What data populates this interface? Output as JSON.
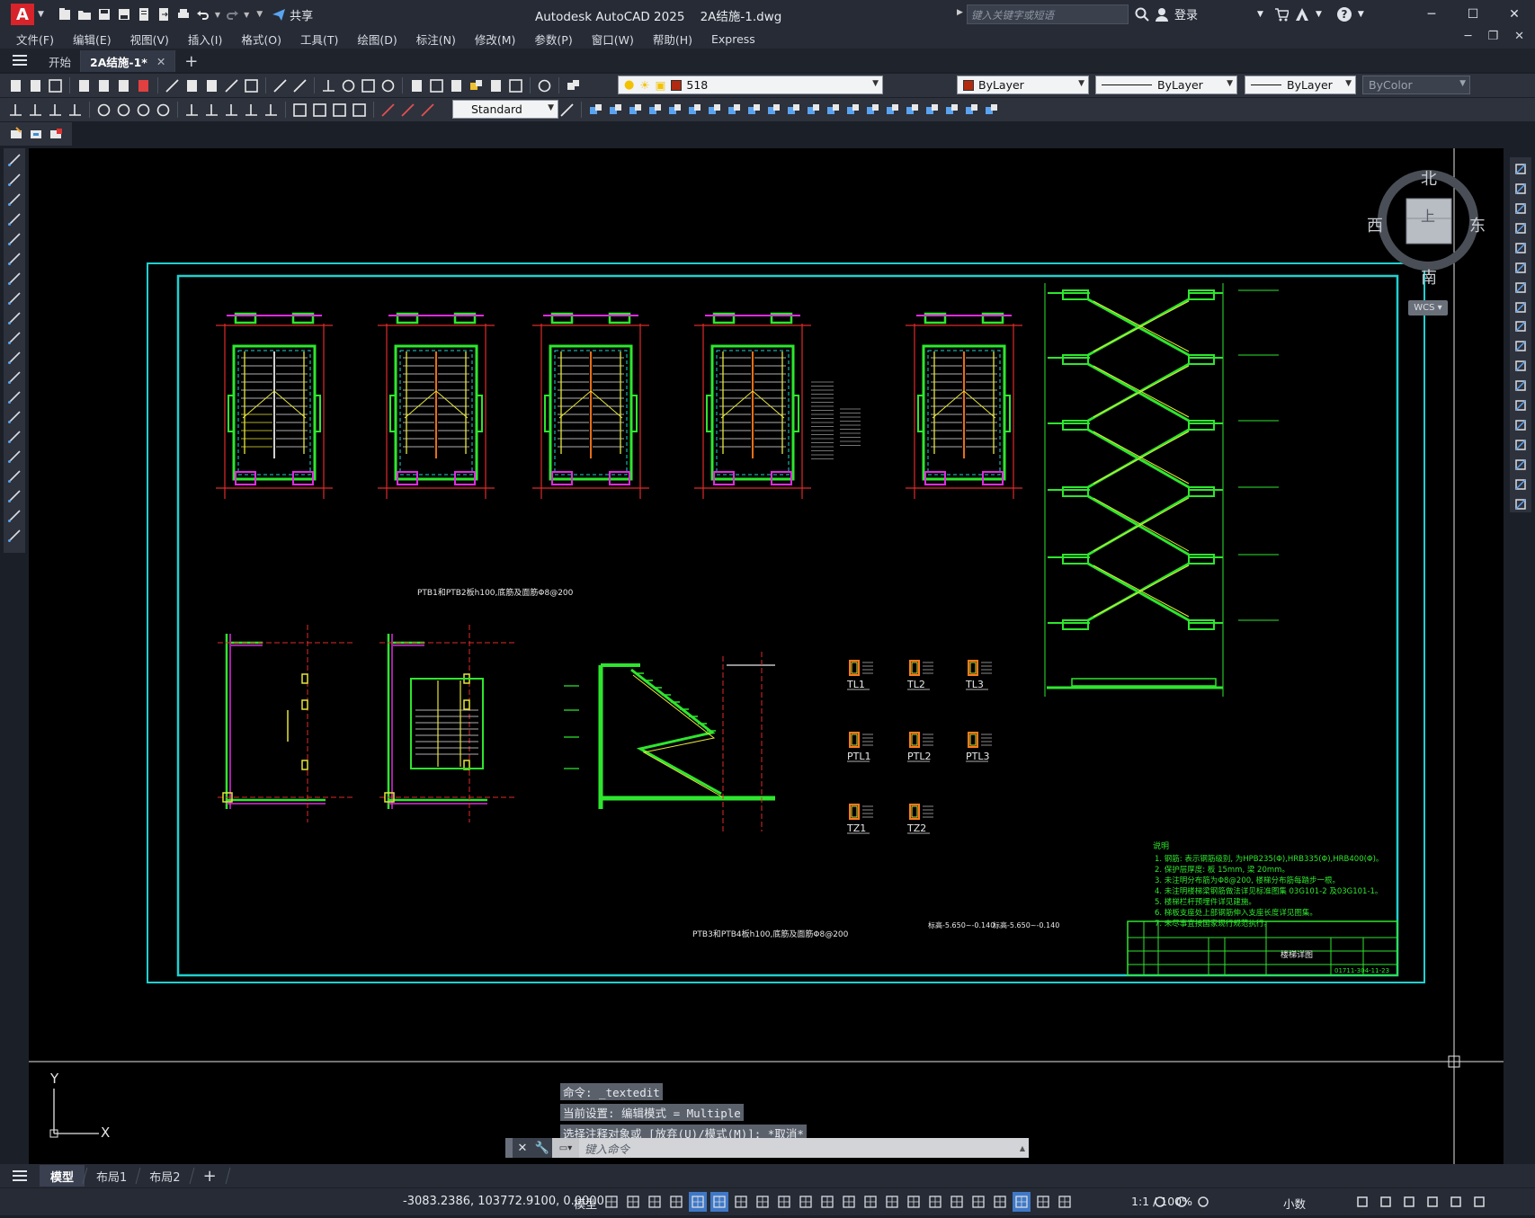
{
  "app": {
    "title": "Autodesk AutoCAD 2025    2A结施-1.dwg",
    "search_placeholder": "键入关键字或短语",
    "login_label": "登录",
    "share_label": "共享"
  },
  "menu": {
    "items": [
      "文件(F)",
      "编辑(E)",
      "视图(V)",
      "插入(I)",
      "格式(O)",
      "工具(T)",
      "绘图(D)",
      "标注(N)",
      "修改(M)",
      "参数(P)",
      "窗口(W)",
      "帮助(H)",
      "Express"
    ]
  },
  "doc_tabs": [
    {
      "label": "开始",
      "active": false
    },
    {
      "label": "2A结施-1*",
      "active": true
    }
  ],
  "toolbar": {
    "text_style": "Standard",
    "layer_name": "518",
    "color": "ByLayer",
    "linetype": "ByLayer",
    "lineweight": "ByLayer",
    "plotstyle": "ByColor"
  },
  "viewcube": {
    "north": "北",
    "south": "南",
    "east": "东",
    "west": "西",
    "face": "上",
    "wcs": "WCS"
  },
  "ucs": {
    "x": "X",
    "y": "Y"
  },
  "drawing": {
    "caption_top": "PTB1和PTB2板h100,底筋及面筋Φ8@200",
    "caption_bottom": "PTB3和PTB4板h100,底筋及面筋Φ8@200",
    "beam_labels": [
      "TL1",
      "TL2",
      "TL3",
      "PTL1",
      "PTL2",
      "PTL3",
      "TZ1",
      "TZ2"
    ],
    "tz1_note": "标高-5.650~-0.140",
    "tz2_note": "标高-5.650~-0.140",
    "notes_title": "说明",
    "notes": [
      "1. 钢筋: 表示钢筋级别, 为HPB235(Φ),HRB335(Φ),HRB400(Φ)。",
      "2. 保护层厚度: 板 15mm, 梁 20mm。",
      "3. 未注明分布筋为Φ8@200, 楼梯分布筋每踏步一根。",
      "4. 未注明楼梯梁钢筋做法详见标准图集 03G101-2 及03G101-1。",
      "5. 楼梯栏杆预埋件详见建施。",
      "6. 梯板支座处上部钢筋伸入支座长度详见图集。",
      "7. 未尽事宜按国家现行规范执行。"
    ],
    "title_block": {
      "name": "楼梯详图",
      "number": "01711-304-11-23"
    }
  },
  "command": {
    "history": [
      "命令: _textedit",
      "当前设置: 编辑模式 = Multiple",
      "选择注释对象或 [放弃(U)/模式(M)]: *取消*"
    ],
    "placeholder": "键入命令"
  },
  "layout_tabs": [
    {
      "label": "模型",
      "active": true
    },
    {
      "label": "布局1",
      "active": false
    },
    {
      "label": "布局2",
      "active": false
    }
  ],
  "status": {
    "coords": "-3083.2386, 103772.9100, 0.0000",
    "space": "模型",
    "scale": "1:1 / 100%",
    "units": "小数"
  }
}
